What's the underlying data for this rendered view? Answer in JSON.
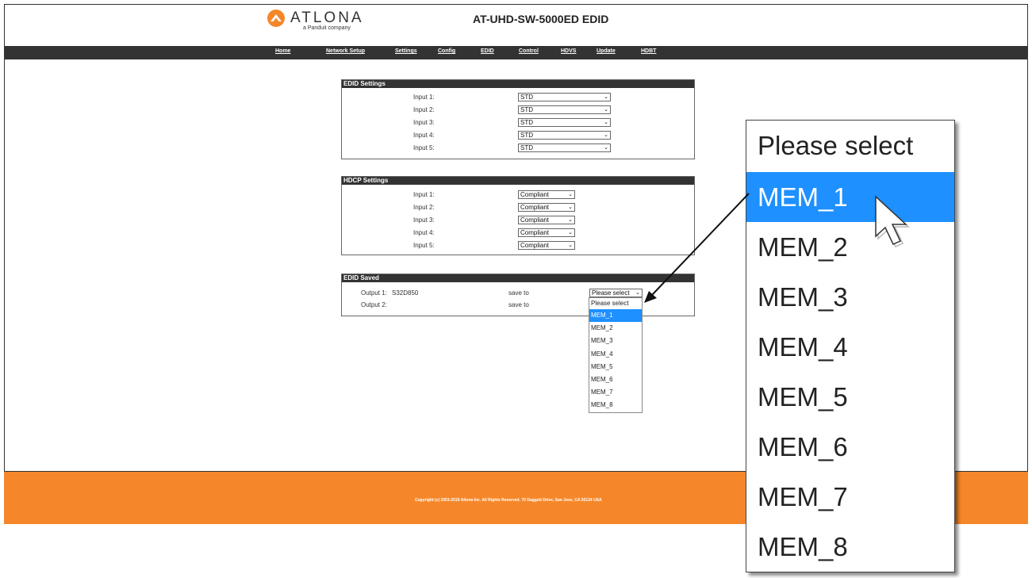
{
  "header": {
    "logo_text": "ATLONA",
    "logo_subtext": "a Panduit company",
    "title": "AT-UHD-SW-5000ED EDID"
  },
  "nav": [
    "Home",
    "Network Setup",
    "Settings",
    "Config",
    "EDID",
    "Control",
    "HDVS",
    "Update",
    "HDBT"
  ],
  "edid_settings": {
    "title": "EDID Settings",
    "rows": [
      {
        "label": "Input 1:",
        "value": "STD"
      },
      {
        "label": "Input 2:",
        "value": "STD"
      },
      {
        "label": "Input 3:",
        "value": "STD"
      },
      {
        "label": "Input 4:",
        "value": "STD"
      },
      {
        "label": "Input 5:",
        "value": "STD"
      }
    ]
  },
  "hdcp_settings": {
    "title": "HDCP Settings",
    "rows": [
      {
        "label": "Input 1:",
        "value": "Compliant"
      },
      {
        "label": "Input 2:",
        "value": "Compliant"
      },
      {
        "label": "Input 3:",
        "value": "Compliant"
      },
      {
        "label": "Input 4:",
        "value": "Compliant"
      },
      {
        "label": "Input 5:",
        "value": "Compliant"
      }
    ]
  },
  "edid_saved": {
    "title": "EDID Saved",
    "rows": [
      {
        "label": "Output 1:",
        "device": "S32D850",
        "action": "save to",
        "select": "Please select"
      },
      {
        "label": "Output 2:",
        "device": "",
        "action": "save to"
      }
    ]
  },
  "dropdown": {
    "options": [
      "Please select",
      "MEM_1",
      "MEM_2",
      "MEM_3",
      "MEM_4",
      "MEM_5",
      "MEM_6",
      "MEM_7",
      "MEM_8"
    ],
    "highlighted": "MEM_1"
  },
  "footer": {
    "copyright": "Copyright (c) 2003-2019 Atlona Inc. All Rights Reserved. 70 Daggett Drive, San Jose, CA 95134 USA"
  },
  "colors": {
    "nav_bg": "#333333",
    "footer_bg": "#f5872a",
    "highlight": "#1e90ff",
    "logo_accent": "#f5872a"
  },
  "icons": {
    "logo": "atlona-logo-icon",
    "chevron": "chevron-down-icon",
    "cursor": "mouse-pointer-icon",
    "callout_arrow": "callout-arrow-icon"
  }
}
